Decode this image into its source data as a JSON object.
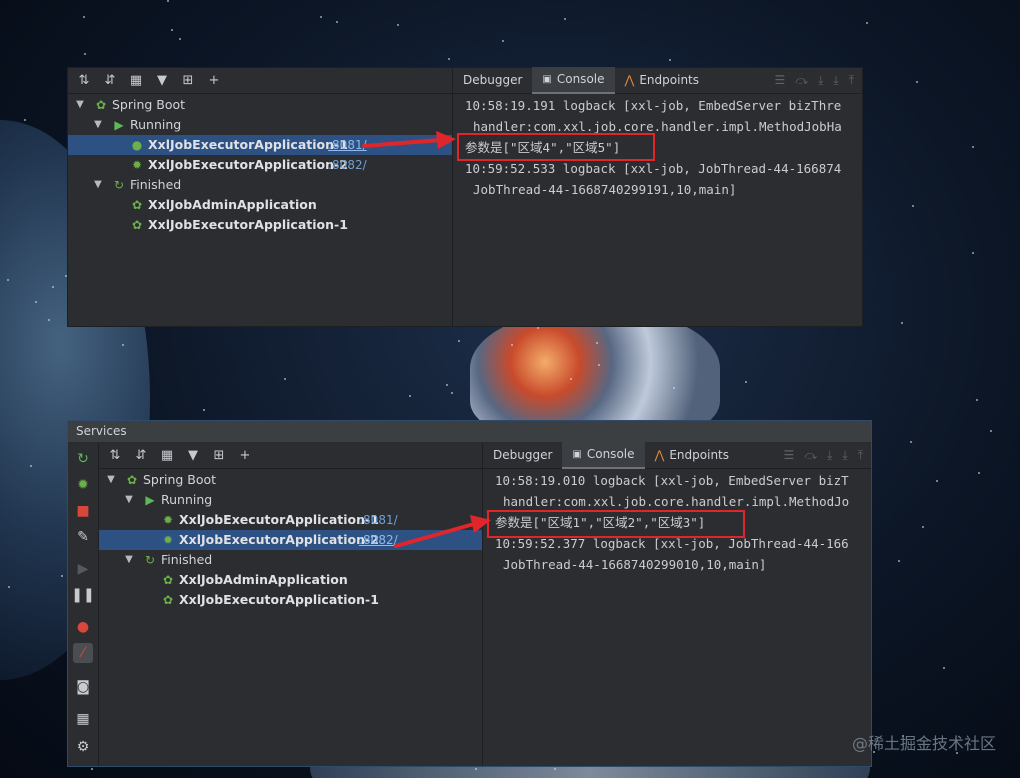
{
  "top_panel": {
    "toolbar_icons": [
      "expand-all-icon",
      "collapse-all-icon",
      "group-icon",
      "filter-icon",
      "new-tab-icon",
      "add-icon"
    ],
    "tree": [
      {
        "label": "Spring Boot",
        "level": 0,
        "icon": "spring-boot-icon",
        "expanded": true
      },
      {
        "label": "Running",
        "level": 1,
        "icon": "run-icon",
        "expanded": true
      },
      {
        "label": "XxlJobExecutorApplication-1",
        "port": ":8081/",
        "level": 2,
        "icon": "debug-running-icon",
        "selected": true
      },
      {
        "label": "XxlJobExecutorApplication-2",
        "port": ":8082/",
        "level": 2,
        "icon": "debug-icon"
      },
      {
        "label": "Finished",
        "level": 1,
        "icon": "rerun-icon",
        "expanded": true
      },
      {
        "label": "XxlJobAdminApplication",
        "level": 2,
        "icon": "spring-app-icon"
      },
      {
        "label": "XxlJobExecutorApplication-1",
        "level": 2,
        "icon": "spring-app-icon"
      }
    ],
    "tabs": [
      "Debugger",
      "Console",
      "Endpoints"
    ],
    "active_tab": "Console",
    "console_lines": [
      "10:58:19.191 logback [xxl-job, EmbedServer bizThre",
      "handler:com.xxl.job.core.handler.impl.MethodJobHa",
      "参数是[\"区域4\",\"区域5\"]",
      "10:59:52.533 logback [xxl-job, JobThread-44-166874",
      "JobThread-44-1668740299191,10,main]"
    ]
  },
  "bottom_panel": {
    "title": "Services",
    "side_icons": [
      "rerun-icon",
      "debug-icon",
      "stop-icon",
      "wrench-icon",
      "resume-icon",
      "pause-icon",
      "breakpoints-icon",
      "mute-breakpoints-icon",
      "camera-icon",
      "layout-icon",
      "settings-icon"
    ],
    "toolbar_icons": [
      "expand-all-icon",
      "collapse-all-icon",
      "group-icon",
      "filter-icon",
      "new-tab-icon",
      "add-icon"
    ],
    "tree": [
      {
        "label": "Spring Boot",
        "level": 0,
        "icon": "spring-boot-icon",
        "expanded": true
      },
      {
        "label": "Running",
        "level": 1,
        "icon": "run-icon",
        "expanded": true
      },
      {
        "label": "XxlJobExecutorApplication-1",
        "port": ":8081/",
        "level": 2,
        "icon": "debug-icon"
      },
      {
        "label": "XxlJobExecutorApplication-2",
        "port": ":8082/",
        "level": 2,
        "icon": "debug-icon",
        "selected": true
      },
      {
        "label": "Finished",
        "level": 1,
        "icon": "rerun-icon",
        "expanded": true
      },
      {
        "label": "XxlJobAdminApplication",
        "level": 2,
        "icon": "spring-app-icon"
      },
      {
        "label": "XxlJobExecutorApplication-1",
        "level": 2,
        "icon": "spring-app-icon"
      }
    ],
    "tabs": [
      "Debugger",
      "Console",
      "Endpoints"
    ],
    "active_tab": "Console",
    "console_lines": [
      "10:58:19.010 logback [xxl-job, EmbedServer bizT",
      "handler:com.xxl.job.core.handler.impl.MethodJo",
      "参数是[\"区域1\",\"区域2\",\"区域3\"]",
      "10:59:52.377 logback [xxl-job, JobThread-44-166",
      "JobThread-44-1668740299010,10,main]"
    ]
  },
  "watermark": "@稀土掘金技术社区",
  "colors": {
    "panel_bg": "#2b2d30",
    "selection": "#2e5183",
    "annotation_red": "#e1262b",
    "port_link": "#6f9fd6",
    "spring_green": "#6cb04a"
  }
}
